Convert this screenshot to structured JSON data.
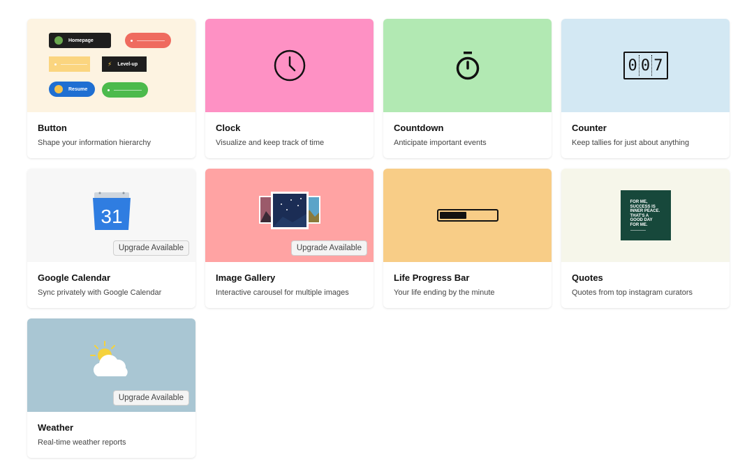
{
  "cards": [
    {
      "title": "Button",
      "desc": "Shape your information hierarchy",
      "bg": "#fdf3e1"
    },
    {
      "title": "Clock",
      "desc": "Visualize and keep track of time",
      "bg": "#fe91c4"
    },
    {
      "title": "Countdown",
      "desc": "Anticipate important events",
      "bg": "#b2e9b3"
    },
    {
      "title": "Counter",
      "desc": "Keep tallies for just about anything",
      "bg": "#d3e8f3"
    },
    {
      "title": "Google Calendar",
      "desc": "Sync privately with Google Calendar",
      "bg": "#f7f7f7",
      "upgrade": "Upgrade Available"
    },
    {
      "title": "Image Gallery",
      "desc": "Interactive carousel for multiple images",
      "bg": "#ffa3a3",
      "upgrade": "Upgrade Available"
    },
    {
      "title": "Life Progress Bar",
      "desc": "Your life ending by the minute",
      "bg": "#f8cd87"
    },
    {
      "title": "Quotes",
      "desc": "Quotes from top instagram curators",
      "bg": "#f6f6ea"
    },
    {
      "title": "Weather",
      "desc": "Real-time weather reports",
      "bg": "#a9c6d3",
      "upgrade": "Upgrade Available"
    }
  ],
  "button_preview": {
    "homepage": "Homepage",
    "levelup": "Level-up",
    "resume": "Resume"
  },
  "counter_preview": {
    "digits": [
      "0",
      "0",
      "7"
    ]
  },
  "calendar_preview": {
    "day": "31"
  },
  "progress_preview": {
    "fraction": 0.48
  },
  "quote_preview": {
    "lines": [
      "FOR ME,",
      "SUCCESS IS",
      "INNER PEACE.",
      "THAT'S A",
      "GOOD DAY",
      "FOR ME."
    ]
  },
  "colors": {
    "button_red": "#ef6b5f",
    "button_yellow": "#fbd57f",
    "button_blue": "#1f6fd2",
    "button_green": "#4cba4c",
    "quote_green": "#17483b",
    "calendar_blue": "#2f7de1"
  }
}
